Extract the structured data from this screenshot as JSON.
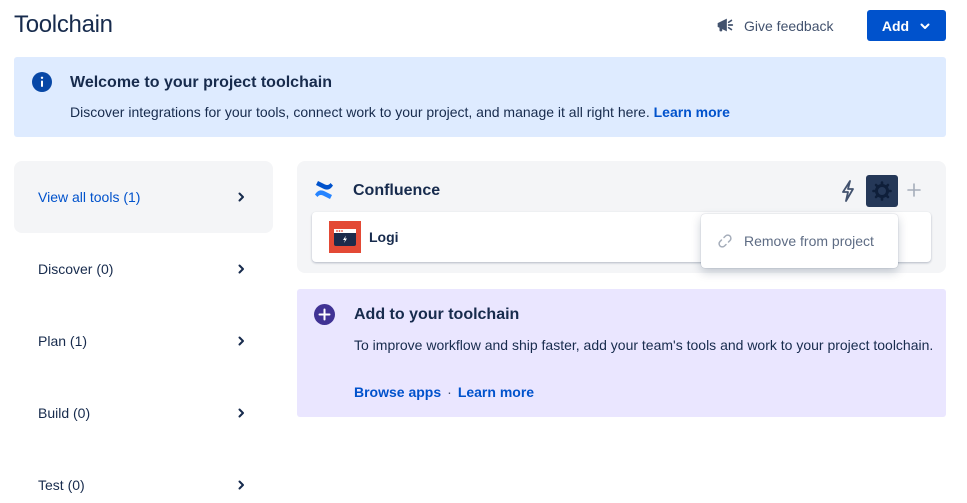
{
  "header": {
    "title": "Toolchain",
    "feedback_label": "Give feedback",
    "add_label": "Add"
  },
  "welcome": {
    "title": "Welcome to your project toolchain",
    "text": "Discover integrations for your tools, connect work to your project, and manage it all right here.",
    "link": "Learn more"
  },
  "sidebar": {
    "items": [
      {
        "label": "View all tools (1)",
        "active": true
      },
      {
        "label": "Discover (0)"
      },
      {
        "label": "Plan (1)"
      },
      {
        "label": "Build (0)"
      },
      {
        "label": "Test (0)"
      }
    ]
  },
  "confluence": {
    "title": "Confluence",
    "tool_name": "Logi",
    "icons": [
      "confluence-logo",
      "bolt-icon",
      "gear-icon",
      "plus-icon"
    ]
  },
  "menu": {
    "remove_label": "Remove from project"
  },
  "add_toolchain": {
    "title": "Add to your toolchain",
    "text": "To improve workflow and ship faster, add your team's tools and work to your project toolchain.",
    "browse_link": "Browse apps",
    "separator": "·",
    "learn_link": "Learn more"
  },
  "colors": {
    "primary": "#0052cc",
    "info_bg": "#deebff",
    "discovery_bg": "#eae6ff",
    "card_bg": "#f4f5f7",
    "logi_red": "#e34935"
  }
}
